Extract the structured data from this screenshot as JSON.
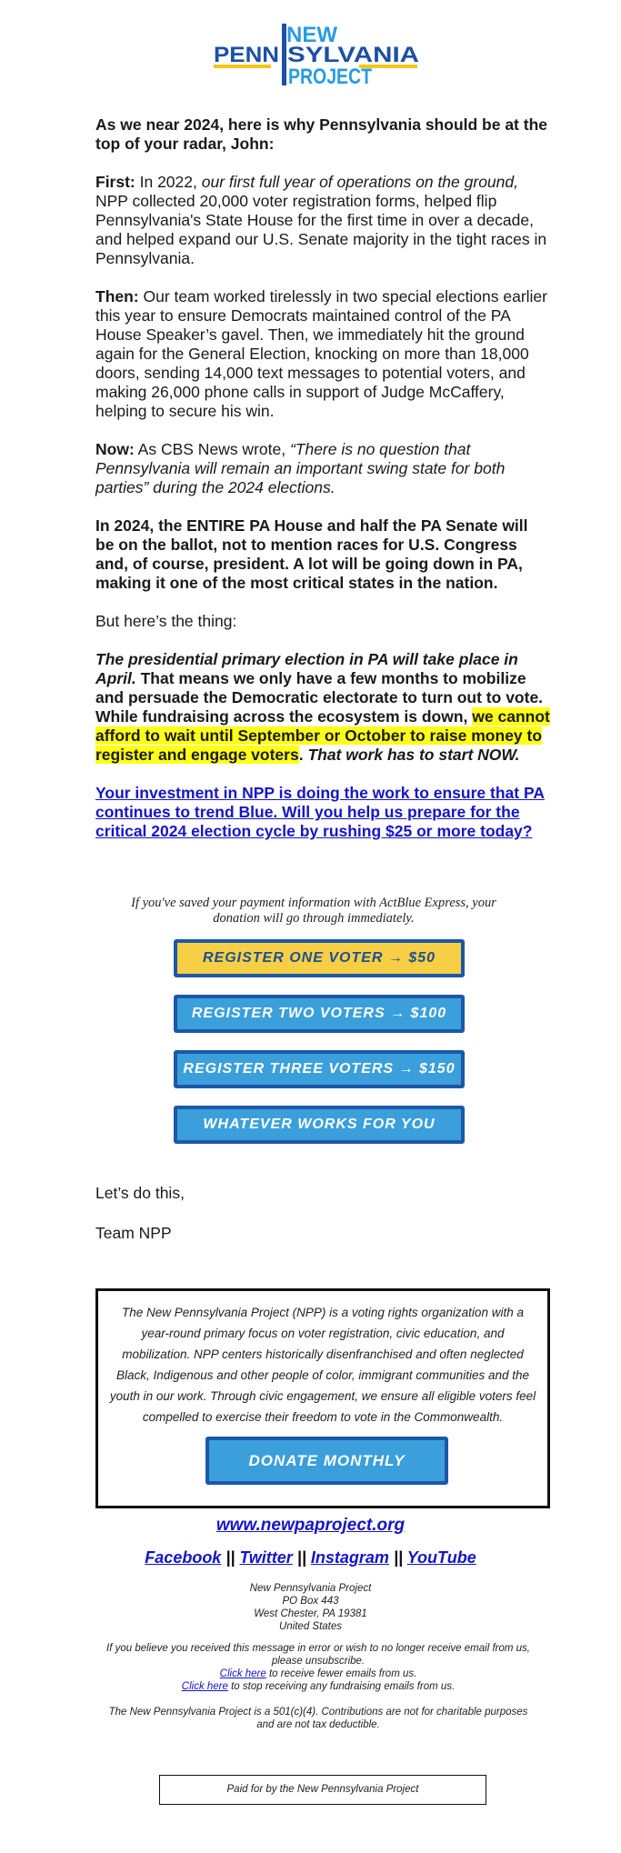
{
  "logo": {
    "line1": "NEW",
    "line2_left": "PENN",
    "line2_right": "SYLVANIA",
    "line3": "PROJECT",
    "colors": {
      "dark_blue": "#1d4fa6",
      "light_blue": "#2a9be0",
      "yellow": "#f5c518"
    }
  },
  "body": {
    "intro": "As we near 2024, here is why Pennsylvania should be at the top of your radar, John:",
    "first": {
      "label": "First:",
      "text_a": " In 2022, ",
      "italic": "our first full year of operations on the ground,",
      "text_b": " NPP collected 20,000 voter registration forms, helped flip Pennsylvania's State House for the first time in over a decade, and helped expand our U.S. Senate majority in the tight races in Pennsylvania."
    },
    "then": {
      "label": "Then:",
      "text": " Our team worked tirelessly in two special elections earlier this year to ensure Democrats maintained control of the PA House Speaker’s gavel. Then, we immediately hit the ground again for the General Election, knocking on more than 18,000 doors, sending 14,000 text messages to potential voters, and making 26,000 phone calls in support of Judge McCaffery, helping to secure his win."
    },
    "now": {
      "label": "Now:",
      "text_a": " As CBS News wrote, ",
      "italic": "“There is no question that Pennsylvania will remain an important swing state for both parties” during the 2024 elections."
    },
    "stakes": "In 2024, the ENTIRE PA House and half the PA Senate will be on the ballot, not to mention races for U.S. Congress and, of course, president. A lot will be going down in PA, making it one of the most critical states in the nation.",
    "but": "But here’s the thing:",
    "urgent": {
      "italic_a": "The presidential primary election in PA will take place in April.",
      "text_a": " That means we only have a few months to mobilize and persuade the Democratic electorate to turn out to vote. While fundraising across the ecosystem is down, ",
      "highlight": "we cannot afford to wait until September or October to raise money to register and engage voters",
      "text_b": ". ",
      "italic_b": "That work has to start NOW."
    },
    "cta_link": "Your investment in NPP is doing the work to ensure that PA continues to trend Blue. Will you help us prepare for the critical 2024 election cycle by rushing $25 or more today?"
  },
  "actblue_note": "If you've saved your payment information with ActBlue Express, your donation will go through immediately.",
  "buttons": [
    {
      "label": "REGISTER ONE VOTER → $50",
      "color": "#f7cf44"
    },
    {
      "label": "REGISTER TWO VOTERS → $100",
      "color": "#3b9fdb"
    },
    {
      "label": "REGISTER THREE VOTERS → $150",
      "color": "#3b9fdb"
    },
    {
      "label": "WHATEVER WORKS FOR YOU",
      "color": "#3b9fdb"
    }
  ],
  "signoff": {
    "line1": "Let’s do this,",
    "line2": "Team NPP"
  },
  "about": {
    "text": "The New Pennsylvania Project (NPP) is a voting rights organization with a year-round primary focus on voter registration, civic education, and mobilization. NPP centers historically disenfranchised and often neglected Black, Indigenous and other people of color, immigrant communities and the youth in our work. Through civic engagement, we ensure all eligible voters feel compelled to exercise their freedom to vote in the Commonwealth.",
    "button": "DONATE MONTHLY"
  },
  "footer": {
    "website": "www.newpaproject.org",
    "social": [
      "Facebook",
      "Twitter",
      "Instagram",
      "YouTube"
    ],
    "separator": "||",
    "address": [
      "New Pennsylvania Project",
      "PO Box 443",
      "West Chester, PA 19381",
      "United States"
    ],
    "unsubscribe": "If you believe you received this message in error or wish to no longer receive email from us, please unsubscribe.",
    "fewer_link": "Click here",
    "fewer_text": " to receive fewer emails from us.",
    "stop_link": "Click here",
    "stop_text": " to stop receiving any fundraising emails from us.",
    "tax_note": "The New Pennsylvania Project is a 501(c)(4). Contributions are not for charitable purposes and are not tax deductible.",
    "paid_for": "Paid for by the New Pennsylvania Project"
  }
}
